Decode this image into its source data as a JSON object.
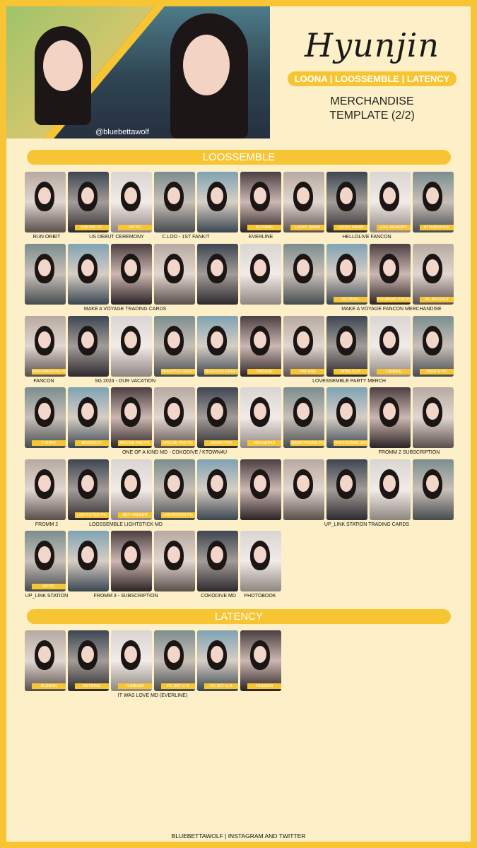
{
  "header": {
    "handle": "@bluebettawolf",
    "name": "Hyunjin",
    "groups": "LOONA | LOOSSEMBLE | LATENCY",
    "merch_line1": "MERCHANDISE",
    "merch_line2": "TEMPLATE (2/2)"
  },
  "sections": {
    "loossemble": "LOOSSEMBLE",
    "latency": "LATENCY"
  },
  "rows": [
    {
      "tags": [
        "",
        "ONLINE PC",
        "VIP PC",
        "",
        "",
        "KEYRING",
        "LUCKY DRAW",
        "LUCKY DRAW",
        "LOG MEMORY",
        "ATTENDANCE"
      ],
      "labels": [
        "RUN ORBIT",
        "US DEBUT CEREMONY",
        "C.LOO - 1ST FANKIT",
        "EVERLINE",
        "HELLOLIVE FANCON"
      ]
    },
    {
      "tags": [
        "",
        "",
        "",
        "",
        "",
        "",
        "",
        "KEYRING",
        "POLAROID PHOTO",
        "PC BROOCH"
      ],
      "labels": [
        "MAKE A VOYAGE TRADING CARDS",
        "MAKE A VOYAGE FANCON MERCHANDISE"
      ]
    },
    {
      "tags": [
        "MERCHANDISE PC",
        "",
        "",
        "SEASON'S GREETING PC",
        "SEASON'S GREETING PC",
        "TINCASE",
        "TINCASE",
        "WINE CUP",
        "CANDLE",
        "MERCH PC"
      ],
      "labels": [
        "FANCON",
        "SG 2024 - OUR VACATION",
        "LOVESSEMBLE PARTY MERCH"
      ]
    },
    {
      "tags": [
        "T-SHIRT",
        "BRACELET",
        "MOUSE PAD PC",
        "MOUSE PAD PC",
        "SMARTTOK",
        "MOUSEPAD",
        "SMARTPHONE PC",
        "PHOTOCARD SET",
        "",
        ""
      ],
      "labels": [
        "ONE OF A KIND MD - COKODIVE / KTOWN4U",
        "FROMM 2 SUBSCRIPTION"
      ]
    },
    {
      "tags": [
        "",
        "LIGHTSTICK PC",
        "KEY HOLDER",
        "LIGHTSTICK PC",
        "",
        "",
        "",
        "",
        "",
        ""
      ],
      "labels": [
        "FROMM 2",
        "LOOSSEMBLE LIGHTSTICK MD",
        "UP_LINK STATION TRADING CARDS"
      ]
    },
    {
      "tags": [
        "VIP PC",
        "",
        "",
        "",
        "",
        ""
      ],
      "labels": [
        "UP_LINK STATION",
        "FROMM 3 - SUBSCRIPTION",
        "COKODIVE MD",
        "PHOTOBOOK"
      ]
    },
    {
      "tags": [
        "SLOGAN",
        "KEYRING",
        "TUMBLER",
        "PC SET V. A",
        "PC SET V. B",
        "FANSIGN"
      ],
      "labels": [
        "IT WAS LOVE MD (EVERLINE)"
      ]
    }
  ],
  "footer": "BLUEBETTAWOLF | INSTAGRAM AND TWITTER",
  "colors": {
    "accent": "#f7c533",
    "background": "#fdf0c8"
  }
}
